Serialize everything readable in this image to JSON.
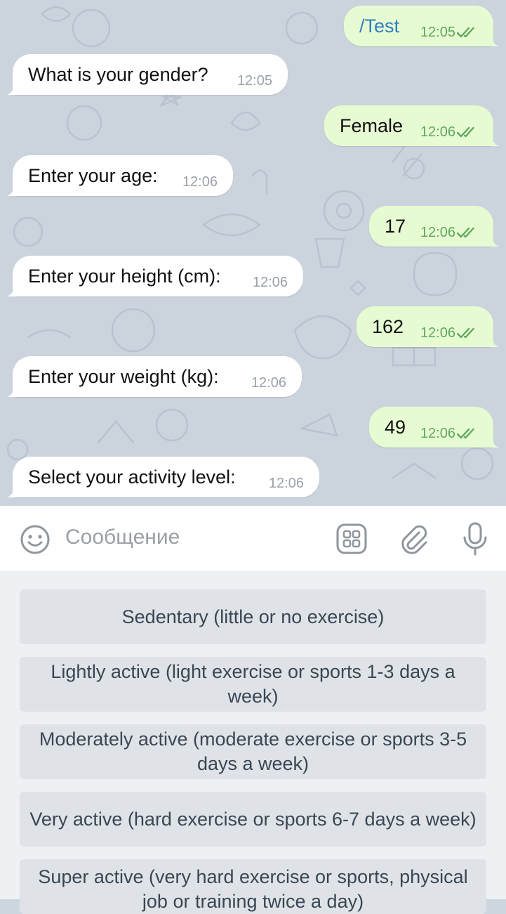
{
  "messages": [
    {
      "direction": "out",
      "text": "/Test",
      "time": "12:05",
      "read": true
    },
    {
      "direction": "in",
      "text": "What is your gender?",
      "time": "12:05"
    },
    {
      "direction": "out",
      "text": "Female",
      "time": "12:06",
      "read": true
    },
    {
      "direction": "in",
      "text": "Enter your age:",
      "time": "12:06"
    },
    {
      "direction": "out",
      "text": "17",
      "time": "12:06",
      "read": true
    },
    {
      "direction": "in",
      "text": "Enter your height (cm):",
      "time": "12:06"
    },
    {
      "direction": "out",
      "text": "162",
      "time": "12:06",
      "read": true
    },
    {
      "direction": "in",
      "text": "Enter your weight (kg):",
      "time": "12:06"
    },
    {
      "direction": "out",
      "text": "49",
      "time": "12:06",
      "read": true
    },
    {
      "direction": "in",
      "text": "Select your activity level:",
      "time": "12:06"
    }
  ],
  "composer": {
    "placeholder": "Сообщение",
    "icons": [
      "emoji-icon",
      "bot-keyboard-icon",
      "attach-icon",
      "microphone-icon"
    ]
  },
  "keyboard": {
    "buttons": [
      "Sedentary (little or no exercise)",
      "Lightly active (light exercise or sports 1-3 days a week)",
      "Moderately active (moderate exercise or sports 3-5 days a week)",
      "Very active (hard exercise or sports 6-7 days a week)",
      "Super active (very hard exercise or sports, physical job or training twice a day)"
    ]
  },
  "colors": {
    "chat_background": "#cbd4dd",
    "incoming_bubble": "#ffffff",
    "outgoing_bubble": "#e7fbd3",
    "outgoing_time": "#5fa85d",
    "command_link": "#2f7fc1"
  }
}
